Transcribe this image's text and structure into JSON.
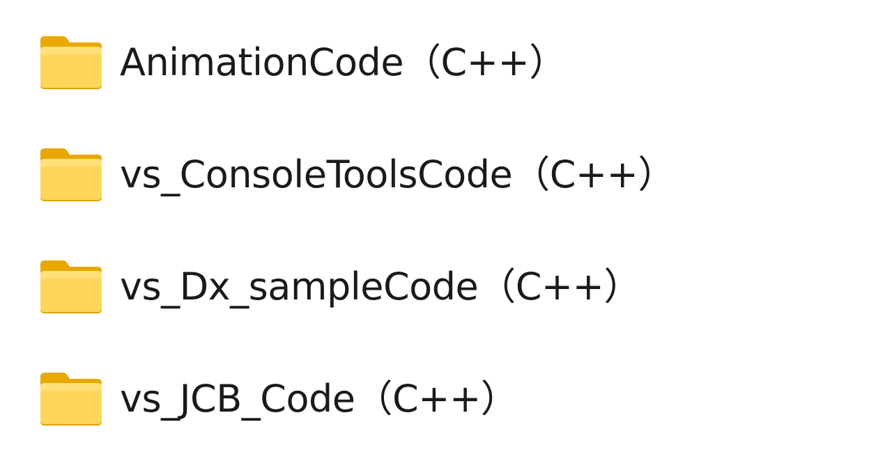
{
  "file_list": {
    "items": [
      {
        "name": "AnimationCode（C++）",
        "icon": "folder-icon"
      },
      {
        "name": "vs_ConsoleToolsCode（C++）",
        "icon": "folder-icon"
      },
      {
        "name": "vs_Dx_sampleCode（C++）",
        "icon": "folder-icon"
      },
      {
        "name": "vs_JCB_Code（C++）",
        "icon": "folder-icon"
      }
    ]
  },
  "colors": {
    "folder_body": "#FFD54F",
    "folder_back": "#F4B400",
    "folder_edge": "#E0A100",
    "text": "#1a1a1a",
    "background": "#ffffff"
  }
}
